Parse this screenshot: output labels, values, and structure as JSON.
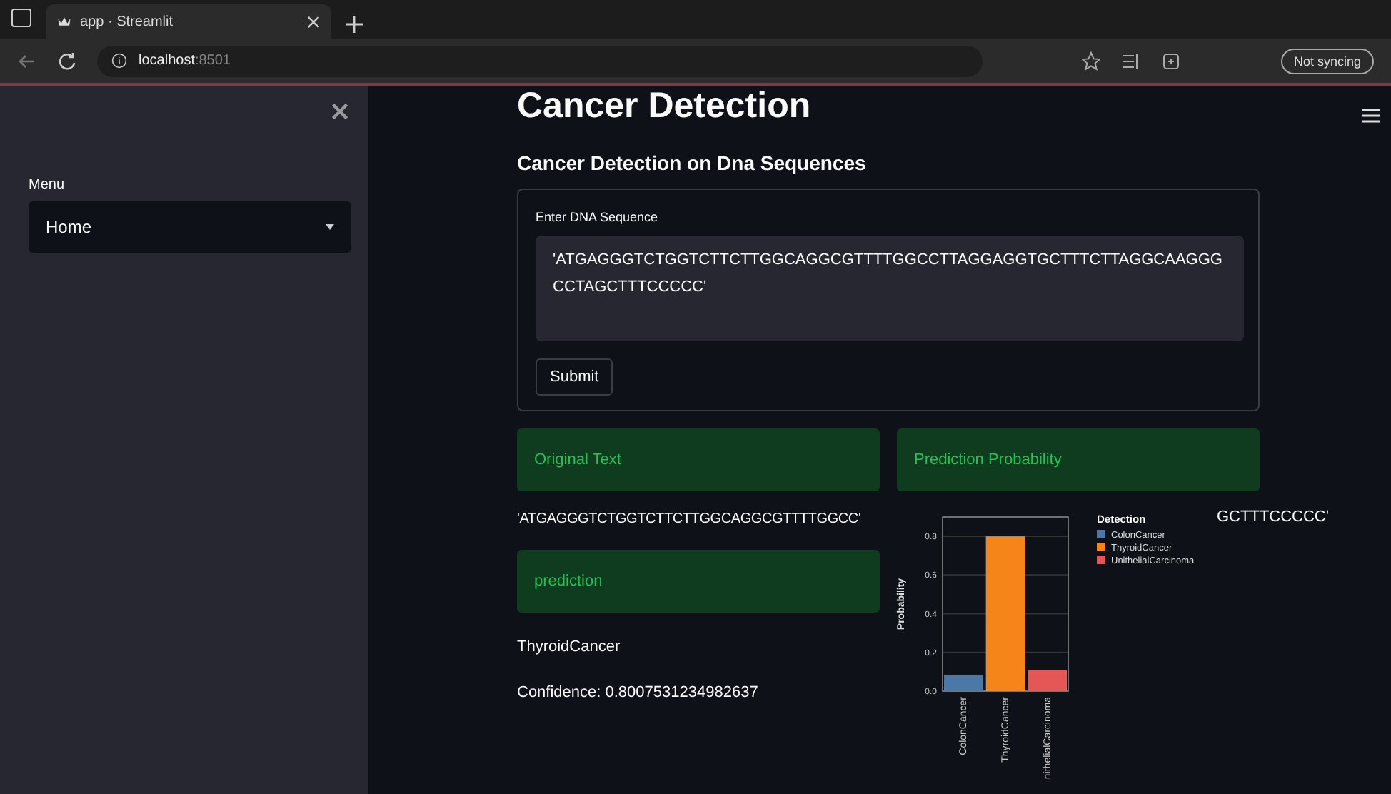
{
  "browser": {
    "tab_title": "app · Streamlit",
    "address_host": "localhost",
    "address_port": ":8501",
    "sync_label": "Not syncing"
  },
  "sidebar": {
    "menu_label": "Menu",
    "menu_value": "Home"
  },
  "main": {
    "title": "Cancer Detection",
    "subtitle": "Cancer Detection on Dna Sequences",
    "form": {
      "label": "Enter DNA Sequence",
      "value": "'ATGAGGGTCTGGTCTTCTTGGCAGGCGTTTTGGCCTTAGGAGGTGCTTTCTTAGGCAAGGGCCTAGCTTTCCCCC'",
      "button": "Submit"
    },
    "original_text": {
      "header": "Original Text",
      "text": "'ATGAGGGTCTGGTCTTCTTGGCAGGCGTTTTGGCC'"
    },
    "prediction": {
      "header": "prediction",
      "result": "ThyroidCancer",
      "confidence": "Confidence: 0.8007531234982637"
    },
    "probability": {
      "header": "Prediction Probability",
      "text_fragment": "GCTTTCCCCC'",
      "chart_data": {
        "type": "bar",
        "ylabel": "Probability",
        "categories": [
          "ColonCancer",
          "ThyroidCancer",
          "nithelialCarcinoma"
        ],
        "series": [
          {
            "name": "ColonCancer",
            "color": "#4c78a8",
            "values": [
              0.085,
              null,
              null
            ]
          },
          {
            "name": "ThyroidCancer",
            "color": "#f58518",
            "values": [
              null,
              0.8,
              null
            ]
          },
          {
            "name": "UnithelialCarcinoma",
            "color": "#e45756",
            "values": [
              null,
              null,
              0.11
            ]
          }
        ],
        "grid": true,
        "legend": {
          "title": "Detection"
        },
        "ylim": [
          0,
          0.9
        ],
        "yticks": [
          {
            "value": 0,
            "label": "0.0"
          },
          {
            "value": 0.2,
            "label": "0.2"
          },
          {
            "value": 0.4,
            "label": "0.4"
          },
          {
            "value": 0.6,
            "label": "0.6"
          },
          {
            "value": 0.8,
            "label": "0.8"
          }
        ]
      }
    }
  }
}
